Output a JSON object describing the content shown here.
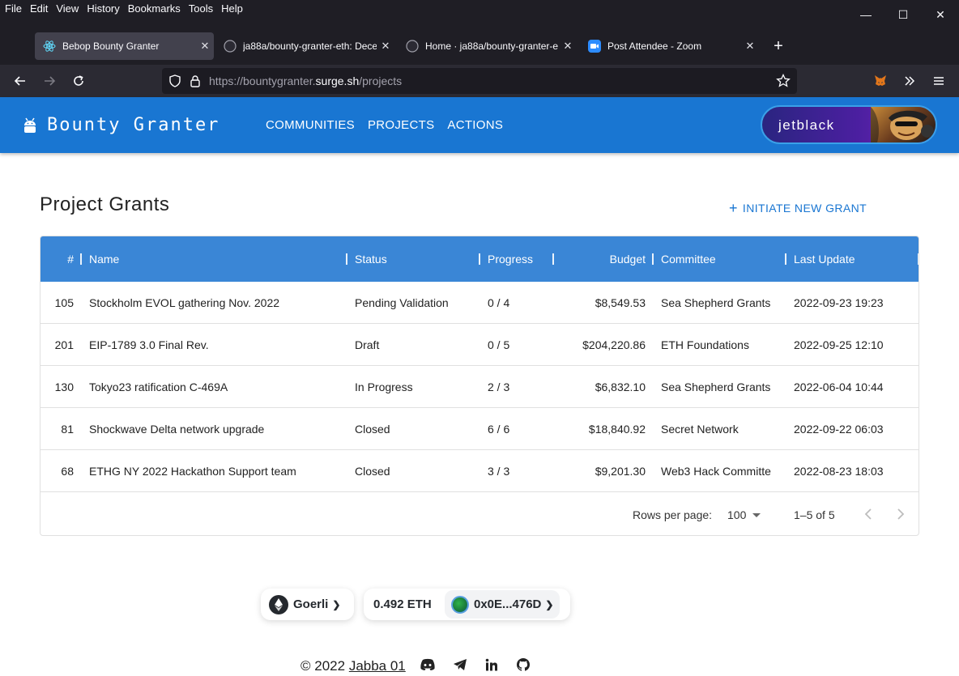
{
  "browser": {
    "menu": [
      "File",
      "Edit",
      "View",
      "History",
      "Bookmarks",
      "Tools",
      "Help"
    ],
    "tabs": [
      {
        "title": "Bebop Bounty Granter",
        "active": true
      },
      {
        "title": "ja88a/bounty-granter-eth: Dece",
        "active": false
      },
      {
        "title": "Home · ja88a/bounty-granter-e",
        "active": false
      },
      {
        "title": "Post Attendee - Zoom",
        "active": false
      }
    ],
    "url_prefix": "https://bountygranter.",
    "url_domain": "surge.sh",
    "url_path": "/projects"
  },
  "app": {
    "brand": "Bounty Granter",
    "nav": [
      "COMMUNITIES",
      "PROJECTS",
      "ACTIONS"
    ],
    "user": "jetblack"
  },
  "page": {
    "title": "Project Grants",
    "new_grant": "INITIATE NEW GRANT"
  },
  "table": {
    "columns": [
      "#",
      "Name",
      "Status",
      "Progress",
      "Budget",
      "Committee",
      "Last Update"
    ],
    "rows": [
      {
        "id": "105",
        "name": "Stockholm EVOL gathering Nov. 2022",
        "status": "Pending Validation",
        "progress": "0 / 4",
        "budget": "$8,549.53",
        "committee": "Sea Shepherd Grants",
        "updated": "2022-09-23 19:23"
      },
      {
        "id": "201",
        "name": "EIP-1789 3.0 Final Rev.",
        "status": "Draft",
        "progress": "0 / 5",
        "budget": "$204,220.86",
        "committee": "ETH Foundations",
        "updated": "2022-09-25 12:10"
      },
      {
        "id": "130",
        "name": "Tokyo23 ratification C-469A",
        "status": "In Progress",
        "progress": "2 / 3",
        "budget": "$6,832.10",
        "committee": "Sea Shepherd Grants",
        "updated": "2022-06-04 10:44"
      },
      {
        "id": "81",
        "name": "Shockwave Delta network upgrade",
        "status": "Closed",
        "progress": "6 / 6",
        "budget": "$18,840.92",
        "committee": "Secret Network",
        "updated": "2022-09-22 06:03"
      },
      {
        "id": "68",
        "name": "ETHG NY 2022 Hackathon Support team",
        "status": "Closed",
        "progress": "3 / 3",
        "budget": "$9,201.30",
        "committee": "Web3 Hack Committe",
        "updated": "2022-08-23 18:03"
      }
    ],
    "rows_per_page_label": "Rows per page:",
    "rows_per_page": "100",
    "range": "1–5 of 5"
  },
  "wallet": {
    "network": "Goerli",
    "balance": "0.492 ETH",
    "address": "0x0E...476D"
  },
  "footer": {
    "copyright": "© 2022",
    "author": "Jabba 01"
  },
  "colors": {
    "appbar": "#1976d2",
    "table_header": "#3a86d6",
    "link": "#1976d2"
  }
}
